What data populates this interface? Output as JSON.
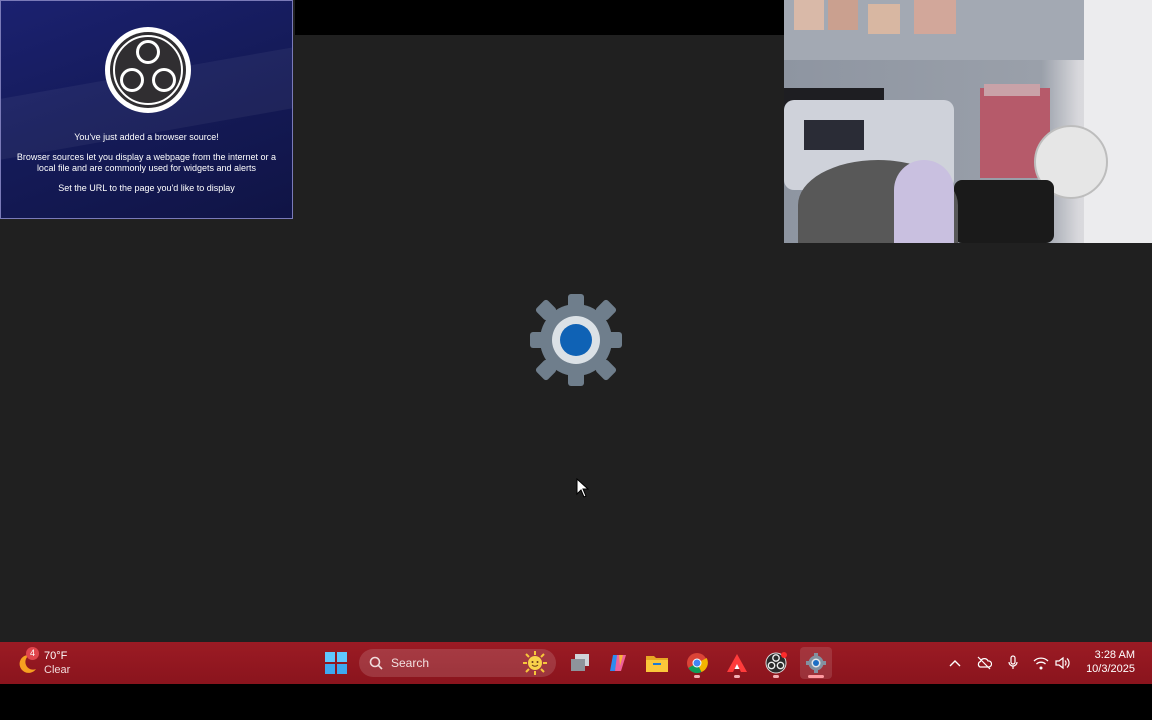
{
  "obs_source": {
    "heading": "You've just added a browser source!",
    "description": "Browser sources let you display a webpage from the internet or a local file and are commonly used for widgets and alerts",
    "instruction": "Set the URL to the page you'd like to display"
  },
  "desktop": {
    "center_icon": "settings-gear-icon",
    "accent_blue": "#0f62b5"
  },
  "taskbar": {
    "color": "#9b1b24",
    "weather": {
      "temp": "70°F",
      "condition": "Clear",
      "badge": "4"
    },
    "search": {
      "label": "Search"
    },
    "apps": [
      {
        "name": "start-button",
        "icon": "windows-logo-icon"
      },
      {
        "name": "task-view-button",
        "icon": "task-view-icon"
      },
      {
        "name": "copilot-button",
        "icon": "copilot-icon"
      },
      {
        "name": "file-explorer-button",
        "icon": "folder-icon"
      },
      {
        "name": "chrome-button",
        "icon": "chrome-icon"
      },
      {
        "name": "app-a-button",
        "icon": "a-logo-icon"
      },
      {
        "name": "obs-button",
        "icon": "obs-icon"
      },
      {
        "name": "settings-button",
        "icon": "gear-icon"
      }
    ],
    "tray": [
      "chevron-up-icon",
      "cloud-off-icon",
      "microphone-icon",
      "wifi-icon",
      "speaker-icon"
    ],
    "clock": {
      "time": "3:28 AM",
      "date": "10/3/2025"
    }
  }
}
